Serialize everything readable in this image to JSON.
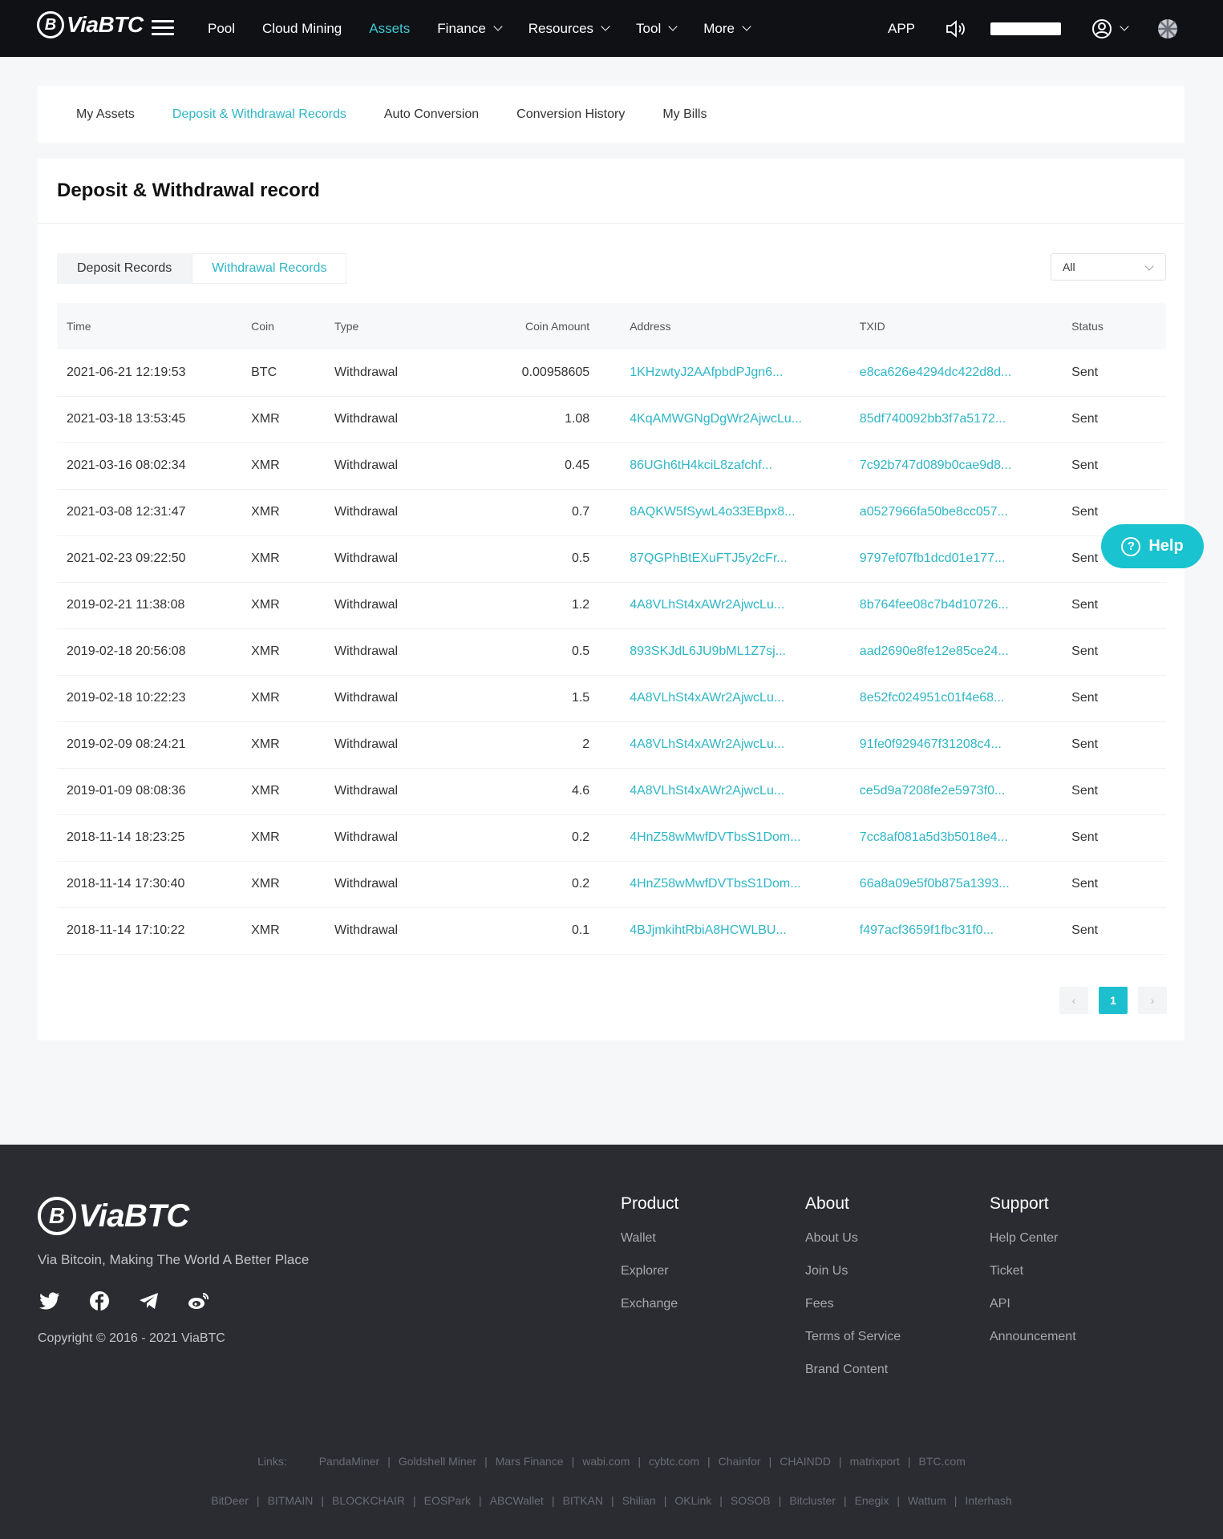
{
  "header": {
    "logo_text": "ViaBTC",
    "nav": [
      {
        "label": "Pool",
        "dropdown": false,
        "active": false
      },
      {
        "label": "Cloud Mining",
        "dropdown": false,
        "active": false
      },
      {
        "label": "Assets",
        "dropdown": false,
        "active": true
      },
      {
        "label": "Finance",
        "dropdown": true,
        "active": false
      },
      {
        "label": "Resources",
        "dropdown": true,
        "active": false
      },
      {
        "label": "Tool",
        "dropdown": true,
        "active": false
      },
      {
        "label": "More",
        "dropdown": true,
        "active": false
      }
    ],
    "app_label": "APP"
  },
  "subtabs": [
    "My Assets",
    "Deposit & Withdrawal Records",
    "Auto Conversion",
    "Conversion History",
    "My Bills"
  ],
  "active_subtab": "Deposit & Withdrawal Records",
  "page": {
    "title": "Deposit & Withdrawal record",
    "record_tabs": [
      "Deposit Records",
      "Withdrawal Records"
    ],
    "active_record_tab": "Withdrawal Records",
    "filter_value": "All"
  },
  "table": {
    "columns": [
      "Time",
      "Coin",
      "Type",
      "Coin Amount",
      "Address",
      "TXID",
      "Status"
    ],
    "rows": [
      [
        "2021-06-21 12:19:53",
        "BTC",
        "Withdrawal",
        "0.00958605",
        "1KHzwtyJ2AAfpbdPJgn6...",
        "e8ca626e4294dc422d8d...",
        "Sent"
      ],
      [
        "2021-03-18 13:53:45",
        "XMR",
        "Withdrawal",
        "1.08",
        "4KqAMWGNgDgWr2AjwcLu...",
        "85df740092bb3f7a5172...",
        "Sent"
      ],
      [
        "2021-03-16 08:02:34",
        "XMR",
        "Withdrawal",
        "0.45",
        "86UGh6tH4kciL8zafchf...",
        "7c92b747d089b0cae9d8...",
        "Sent"
      ],
      [
        "2021-03-08 12:31:47",
        "XMR",
        "Withdrawal",
        "0.7",
        "8AQKW5fSywL4o33EBpx8...",
        "a0527966fa50be8cc057...",
        "Sent"
      ],
      [
        "2021-02-23 09:22:50",
        "XMR",
        "Withdrawal",
        "0.5",
        "87QGPhBtEXuFTJ5y2cFr...",
        "9797ef07fb1dcd01e177...",
        "Sent"
      ],
      [
        "2019-02-21 11:38:08",
        "XMR",
        "Withdrawal",
        "1.2",
        "4A8VLhSt4xAWr2AjwcLu...",
        "8b764fee08c7b4d10726...",
        "Sent"
      ],
      [
        "2019-02-18 20:56:08",
        "XMR",
        "Withdrawal",
        "0.5",
        "893SKJdL6JU9bML1Z7sj...",
        "aad2690e8fe12e85ce24...",
        "Sent"
      ],
      [
        "2019-02-18 10:22:23",
        "XMR",
        "Withdrawal",
        "1.5",
        "4A8VLhSt4xAWr2AjwcLu...",
        "8e52fc024951c01f4e68...",
        "Sent"
      ],
      [
        "2019-02-09 08:24:21",
        "XMR",
        "Withdrawal",
        "2",
        "4A8VLhSt4xAWr2AjwcLu...",
        "91fe0f929467f31208c4...",
        "Sent"
      ],
      [
        "2019-01-09 08:08:36",
        "XMR",
        "Withdrawal",
        "4.6",
        "4A8VLhSt4xAWr2AjwcLu...",
        "ce5d9a7208fe2e5973f0...",
        "Sent"
      ],
      [
        "2018-11-14 18:23:25",
        "XMR",
        "Withdrawal",
        "0.2",
        "4HnZ58wMwfDVTbsS1Dom...",
        "7cc8af081a5d3b5018e4...",
        "Sent"
      ],
      [
        "2018-11-14 17:30:40",
        "XMR",
        "Withdrawal",
        "0.2",
        "4HnZ58wMwfDVTbsS1Dom...",
        "66a8a09e5f0b875a1393...",
        "Sent"
      ],
      [
        "2018-11-14 17:10:22",
        "XMR",
        "Withdrawal",
        "0.1",
        "4BJjmkihtRbiA8HCWLBU...",
        "f497acf3659f1fbc31f0...",
        "Sent"
      ]
    ]
  },
  "pagination": {
    "current": "1"
  },
  "help_label": "Help",
  "footer": {
    "logo_text": "ViaBTC",
    "slogan": "Via Bitcoin, Making The World A Better Place",
    "copyright": "Copyright © 2016 - 2021 ViaBTC",
    "columns": [
      {
        "title": "Product",
        "items": [
          "Wallet",
          "Explorer",
          "Exchange"
        ]
      },
      {
        "title": "About",
        "items": [
          "About Us",
          "Join Us",
          "Fees",
          "Terms of Service",
          "Brand Content"
        ]
      },
      {
        "title": "Support",
        "items": [
          "Help Center",
          "Ticket",
          "API",
          "Announcement"
        ]
      }
    ],
    "links_label": "Links:",
    "links_row1": [
      "PandaMiner",
      "Goldshell Miner",
      "Mars Finance",
      "wabi.com",
      "cybtc.com",
      "Chainfor",
      "CHAINDD",
      "matrixport",
      "BTC.com"
    ],
    "links_row2": [
      "BitDeer",
      "BITMAIN",
      "BLOCKCHAIR",
      "EOSPark",
      "ABCWallet",
      "BITKAN",
      "Shilian",
      "OKLink",
      "SOSOB",
      "Bitcluster",
      "Enegix",
      "Wattum",
      "Interhash"
    ]
  },
  "colors": {
    "accent": "#2fb6c6",
    "help": "#19c3cf",
    "header_bg": "#0f1115",
    "footer_bg": "#2a2c31"
  }
}
